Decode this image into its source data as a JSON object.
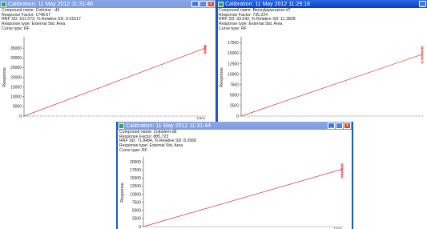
{
  "windows": [
    {
      "title": "Calibration: 11 May 2012 11:31:46",
      "active": false,
      "info": [
        "Compound name: Cotinine - d3",
        "Response Factor: 1748.67",
        "RRF SD: 161.573,  % Relative SD: 9.01517",
        "Response type: External Std, Area",
        "Curve type: RF"
      ],
      "y_axis_label": "Response",
      "x_axis_label": "Conc",
      "buttons": {
        "minimize": "_",
        "maximize": "□",
        "close": "x"
      }
    },
    {
      "title": "Calibration: 11 May 2012 11:29:18",
      "active": true,
      "info": [
        "Compound name: Benzylpiperazine-d7",
        "Response Factor: 735.224",
        "RRF SD: 93.542,  % Relative SD: 11.3828",
        "Response type: External Std, Area",
        "Curve type: RF"
      ],
      "y_axis_label": "Response",
      "buttons": {
        "minimize": "_",
        "maximize": "□",
        "close": "x"
      }
    },
    {
      "title": "Calibration: 11 May 2012 11:31:44",
      "active": false,
      "info": [
        "Compound name: Zolpidem-d6",
        "Response Factor: 885.723",
        "RRF SD: 71.8484,  % Relative SD: 8.2068",
        "Response type: External Std, Area",
        "Curve type: RF"
      ],
      "y_axis_label": "Response",
      "x_axis_label": "Conc",
      "buttons": {
        "minimize": "_",
        "maximize": "□",
        "close": "x"
      }
    }
  ],
  "chart_data": [
    {
      "type": "scatter",
      "title": "",
      "xlabel": "Conc",
      "ylabel": "Response",
      "ylim": [
        0,
        40000
      ],
      "y_ticks": [
        "0",
        "5000",
        "10000",
        "15000",
        "20000",
        "25000",
        "30000",
        "35000"
      ],
      "fit_line": {
        "y_start": 0,
        "y_end": 35000
      },
      "points_y": [
        32500,
        33300,
        34100,
        34800,
        35500,
        36100
      ],
      "line_color": "#e03030",
      "point_color": "#e03030"
    },
    {
      "type": "scatter",
      "title": "",
      "xlabel": "",
      "ylabel": "Response",
      "ylim": [
        0,
        18500
      ],
      "y_ticks": [
        "0",
        "2500",
        "5000",
        "7500",
        "10000",
        "12500",
        "15000",
        "17500"
      ],
      "fit_line": {
        "y_start": 0,
        "y_end": 14700
      },
      "points_y": [
        12800,
        13600,
        14200,
        14800,
        15300,
        15900,
        16400
      ],
      "line_color": "#e03030",
      "point_color": "#e03030"
    },
    {
      "type": "scatter",
      "title": "",
      "xlabel": "Conc",
      "ylabel": "Response",
      "ylim": [
        0,
        21000
      ],
      "y_ticks": [
        "0",
        "2500",
        "5000",
        "7500",
        "10000",
        "12500",
        "15000",
        "17500",
        "20000"
      ],
      "fit_line": {
        "y_start": 0,
        "y_end": 17700
      },
      "points_y": [
        15300,
        15900,
        16500,
        17100,
        17600,
        18200,
        18700,
        19200
      ],
      "line_color": "#e03030",
      "point_color": "#e03030"
    }
  ]
}
